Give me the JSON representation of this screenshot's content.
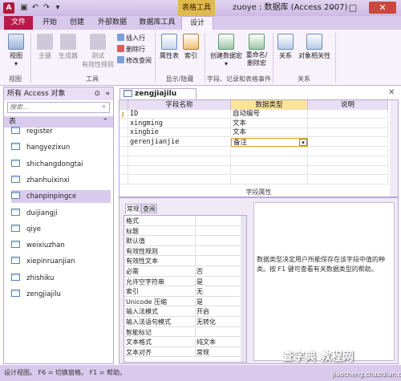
{
  "titlebar": {
    "app_icon": "A",
    "table_tools": "表格工具",
    "title": "zuoye : 数据库 (Access 2007)",
    "min": "–",
    "max": "□",
    "close": "✕"
  },
  "quick_access": [
    "save-icon",
    "undo-icon",
    "redo-icon",
    "dropdown-icon"
  ],
  "tabs": {
    "file": "文件",
    "home": "开始",
    "create": "创建",
    "external": "外部数据",
    "dbtools": "数据库工具",
    "design": "设计"
  },
  "ribbon": {
    "view": "视图",
    "primary_key": "主键",
    "builder": "生成器",
    "test": "测试",
    "validation": "有效性规则",
    "insert_rows": "插入行",
    "delete_rows": "删除行",
    "modify_lookups": "修改查阅",
    "property_sheet": "属性表",
    "indexes": "索引",
    "create_macros": "创建数据宏",
    "rename_delete": "重命名/删除宏",
    "relationships": "关系",
    "object_deps": "对象相关性",
    "group_views": "视图",
    "group_tools": "工具",
    "group_showhide": "显示/隐藏",
    "group_events": "字段、记录和表格事件",
    "group_relationships": "关系"
  },
  "nav": {
    "header": "所有 Access 对象",
    "search_placeholder": "搜索...",
    "group": "表",
    "items": [
      "register",
      "hangyezixun",
      "shichangdongtai",
      "zhanhuixinxi",
      "chanpinpingce",
      "duijiangji",
      "qiye",
      "weixiuzhan",
      "xiepinruanjian",
      "zhishiku",
      "zengjiajilu"
    ]
  },
  "doc": {
    "tab": "zengjiajilu",
    "close": "✕"
  },
  "grid": {
    "col_name": "字段名称",
    "col_type": "数据类型",
    "col_desc": "说明",
    "rows": [
      {
        "name": "ID",
        "type": "自动编号"
      },
      {
        "name": "xingming",
        "type": "文本"
      },
      {
        "name": "xingbie",
        "type": "文本"
      },
      {
        "name": "gerenjianjie",
        "type": "备注"
      }
    ]
  },
  "props": {
    "label": "字段属性",
    "tab_general": "常规",
    "tab_lookup": "查阅",
    "rows": [
      {
        "k": "格式",
        "v": ""
      },
      {
        "k": "标题",
        "v": ""
      },
      {
        "k": "默认值",
        "v": ""
      },
      {
        "k": "有效性规则",
        "v": ""
      },
      {
        "k": "有效性文本",
        "v": ""
      },
      {
        "k": "必需",
        "v": "否"
      },
      {
        "k": "允许空字符串",
        "v": "是"
      },
      {
        "k": "索引",
        "v": "无"
      },
      {
        "k": "Unicode 压缩",
        "v": "是"
      },
      {
        "k": "输入法模式",
        "v": "开启"
      },
      {
        "k": "输入法语句模式",
        "v": "无转化"
      },
      {
        "k": "智能标记",
        "v": ""
      },
      {
        "k": "文本格式",
        "v": "纯文本"
      },
      {
        "k": "文本对齐",
        "v": "常规"
      }
    ],
    "help": "数据类型决定用户所能保存在该字段中值的种类。按 F1 键可查看有关数据类型的帮助。"
  },
  "status": "设计视图。 F6 = 切换窗格。 F1 = 帮助。",
  "watermark": "查字典 教程网",
  "watermark2": "jiaocheng.chazidian.com",
  "colors": {
    "accent": "#b7194b",
    "ribbon": "#f7f2fb",
    "chrome": "#d9c9ec"
  }
}
